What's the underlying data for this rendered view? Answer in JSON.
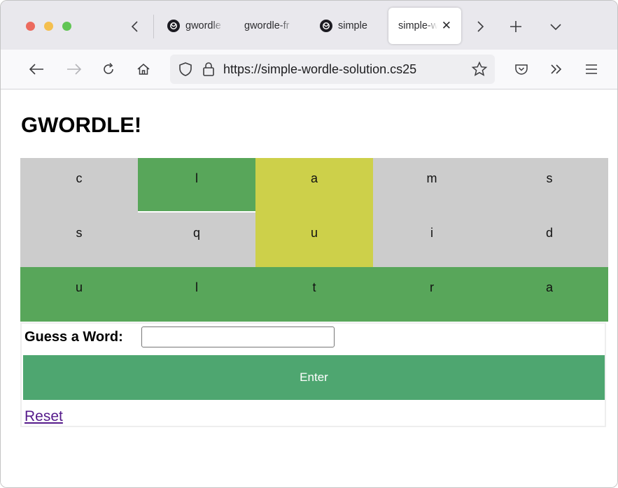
{
  "browser": {
    "tabs": [
      {
        "label": "gwordle",
        "has_favicon": true,
        "active": false
      },
      {
        "label": "gwordle-fr",
        "has_favicon": false,
        "active": false
      },
      {
        "label": "simple",
        "has_favicon": true,
        "active": false
      },
      {
        "label": "simple-w",
        "has_favicon": false,
        "active": true
      }
    ],
    "url": "https://simple-wordle-solution.cs25",
    "icons": {
      "back": "arrow-left-icon",
      "forward": "arrow-right-icon",
      "reload": "reload-icon",
      "home": "home-icon",
      "shield": "shield-icon",
      "lock": "lock-icon",
      "bookmark": "star-icon",
      "pocket": "pocket-icon",
      "overflow": "chevron-double-right-icon",
      "menu": "hamburger-menu-icon"
    }
  },
  "page": {
    "title": "GWORDLE!",
    "board": [
      [
        {
          "letter": "c",
          "state": "absent"
        },
        {
          "letter": "l",
          "state": "correct"
        },
        {
          "letter": "a",
          "state": "present"
        },
        {
          "letter": "m",
          "state": "absent"
        },
        {
          "letter": "s",
          "state": "absent"
        }
      ],
      [
        {
          "letter": "s",
          "state": "absent"
        },
        {
          "letter": "q",
          "state": "absent"
        },
        {
          "letter": "u",
          "state": "present"
        },
        {
          "letter": "i",
          "state": "absent"
        },
        {
          "letter": "d",
          "state": "absent"
        }
      ],
      [
        {
          "letter": "u",
          "state": "correct"
        },
        {
          "letter": "l",
          "state": "correct"
        },
        {
          "letter": "t",
          "state": "correct"
        },
        {
          "letter": "r",
          "state": "correct"
        },
        {
          "letter": "a",
          "state": "correct"
        }
      ]
    ],
    "guess_label": "Guess a Word:",
    "guess_value": "",
    "enter_label": "Enter",
    "reset_label": "Reset",
    "colors": {
      "absent": "#cccccc",
      "correct": "#58a65a",
      "present": "#cdd04a",
      "enter_button": "#4ea670",
      "link": "#551a8b"
    }
  }
}
